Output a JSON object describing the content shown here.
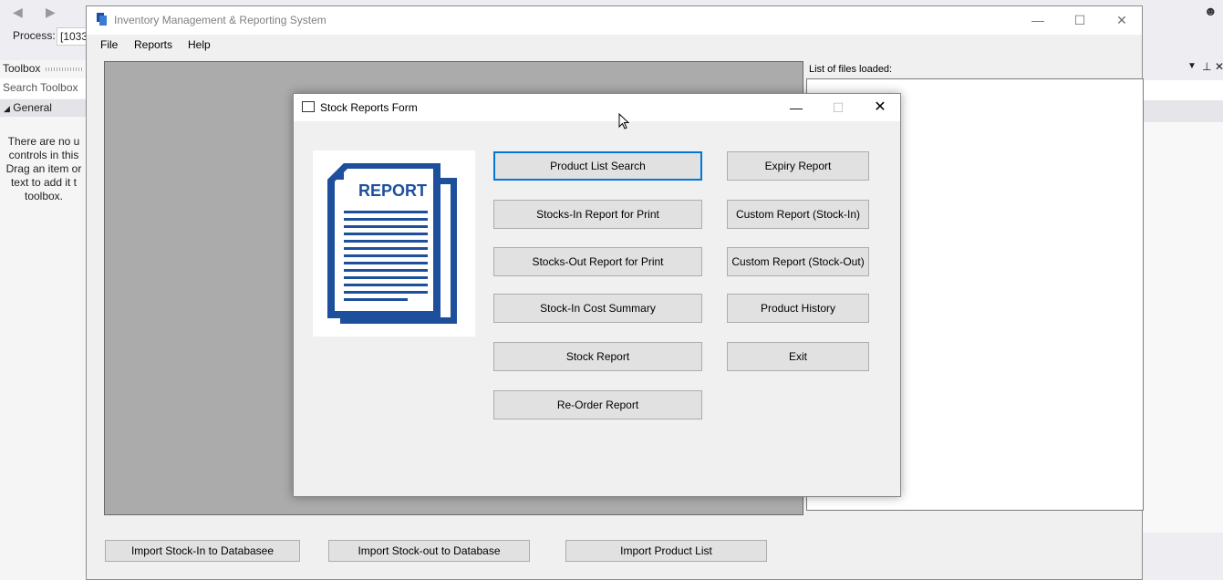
{
  "vs": {
    "process_label": "Process:",
    "process_value": "[1033",
    "toolbox_title": "Toolbox",
    "toolbox_search": "Search Toolbox",
    "toolbox_group": "General",
    "toolbox_empty_lines": [
      "There are no u",
      "controls in this",
      "Drag an item or",
      "text to add it t",
      "toolbox."
    ]
  },
  "window": {
    "title": "Inventory Management & Reporting System",
    "menu": [
      "File",
      "Reports",
      "Help"
    ],
    "files_label": "List of files loaded:",
    "import_buttons": [
      "Import Stock-In to Databasee",
      "Import Stock-out to Database",
      "Import Product List"
    ]
  },
  "dialog": {
    "title": "Stock Reports Form",
    "image_text": "REPORT",
    "left_buttons": [
      "Product List Search",
      "Stocks-In Report for Print",
      "Stocks-Out Report for Print",
      "Stock-In Cost Summary",
      "Stock Report",
      "Re-Order Report"
    ],
    "right_buttons": [
      "Expiry Report",
      "Custom Report (Stock-In)",
      "Custom Report (Stock-Out)",
      "Product History",
      "Exit"
    ]
  },
  "colors": {
    "report_blue": "#1d4f9c",
    "focus_border": "#0078d7"
  }
}
